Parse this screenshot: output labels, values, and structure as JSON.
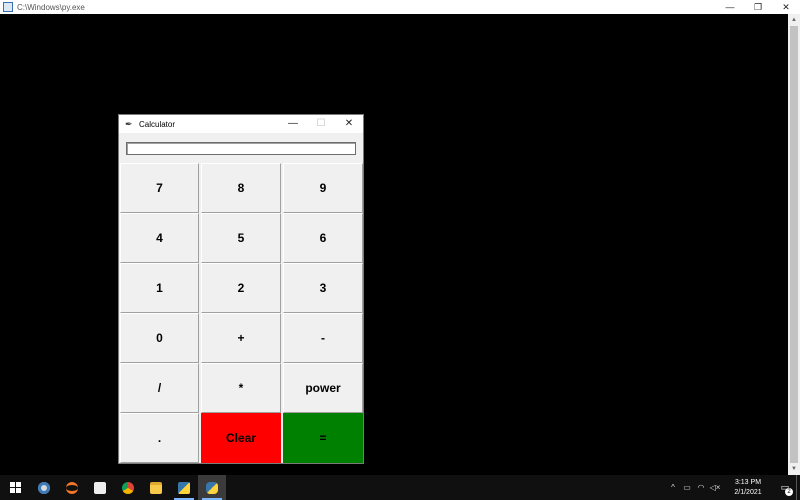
{
  "console": {
    "title": "C:\\Windows\\py.exe",
    "controls": {
      "minimize": "—",
      "restore": "❐",
      "close": "✕"
    }
  },
  "calculator": {
    "title": "Calculator",
    "controls": {
      "minimize": "—",
      "maximize": "☐",
      "close": "✕"
    },
    "display_value": "",
    "keys": [
      {
        "label": "7"
      },
      {
        "label": "8"
      },
      {
        "label": "9"
      },
      {
        "label": "4"
      },
      {
        "label": "5"
      },
      {
        "label": "6"
      },
      {
        "label": "1"
      },
      {
        "label": "2"
      },
      {
        "label": "3"
      },
      {
        "label": "0"
      },
      {
        "label": "+"
      },
      {
        "label": "-"
      },
      {
        "label": "/"
      },
      {
        "label": "*"
      },
      {
        "label": "power"
      },
      {
        "label": "."
      },
      {
        "label": "Clear"
      },
      {
        "label": "="
      }
    ],
    "colors": {
      "clear": "#ff0000",
      "equals": "#008000",
      "key_bg": "#f0f0f0"
    }
  },
  "taskbar": {
    "apps": [
      {
        "icon": "start-windows-icon"
      },
      {
        "icon": "idle-python-icon"
      },
      {
        "icon": "jupyter-icon"
      },
      {
        "icon": "document-viewer-icon"
      },
      {
        "icon": "chrome-icon"
      },
      {
        "icon": "file-explorer-icon"
      },
      {
        "icon": "python-launcher-icon"
      },
      {
        "icon": "python-icon"
      }
    ],
    "clock_time": "3:13 PM",
    "clock_date": "2/1/2021",
    "notification_count": "2"
  }
}
